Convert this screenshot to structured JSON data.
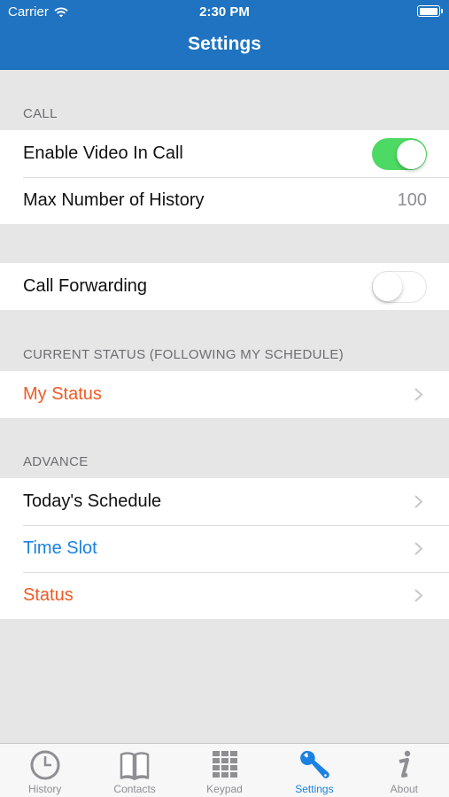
{
  "status_bar": {
    "carrier": "Carrier",
    "time": "2:30 PM"
  },
  "nav": {
    "title": "Settings"
  },
  "sections": {
    "call": {
      "header": "CALL",
      "video_label": "Enable Video In Call",
      "video_enabled": true,
      "history_label": "Max Number of History",
      "history_value": "100"
    },
    "forwarding": {
      "label": "Call Forwarding",
      "enabled": false
    },
    "current_status": {
      "header": "CURRENT STATUS (FOLLOWING MY SCHEDULE)",
      "my_status": "My Status"
    },
    "advance": {
      "header": "ADVANCE",
      "schedule": "Today's Schedule",
      "time_slot": "Time Slot",
      "status": "Status"
    }
  },
  "tabs": [
    {
      "label": "History",
      "icon": "clock-icon"
    },
    {
      "label": "Contacts",
      "icon": "book-icon"
    },
    {
      "label": "Keypad",
      "icon": "keypad-icon"
    },
    {
      "label": "Settings",
      "icon": "wrench-icon",
      "active": true
    },
    {
      "label": "About",
      "icon": "info-icon"
    }
  ],
  "colors": {
    "nav_bar": "#1f73c0",
    "accent_blue": "#1a82e2",
    "accent_orange": "#f05a24",
    "toggle_on": "#4cd964"
  }
}
